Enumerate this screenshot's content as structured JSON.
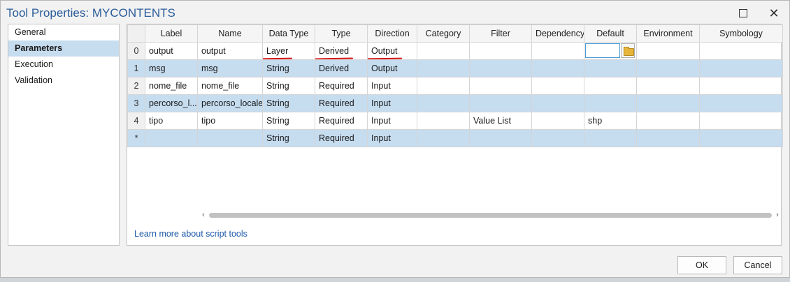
{
  "window": {
    "title": "Tool Properties: MYCONTENTS"
  },
  "nav": {
    "items": [
      {
        "label": "General",
        "selected": false
      },
      {
        "label": "Parameters",
        "selected": true
      },
      {
        "label": "Execution",
        "selected": false
      },
      {
        "label": "Validation",
        "selected": false
      }
    ]
  },
  "grid": {
    "columns": [
      "Label",
      "Name",
      "Data Type",
      "Type",
      "Direction",
      "Category",
      "Filter",
      "Dependency",
      "Default",
      "Environment",
      "Symbology"
    ],
    "rows": [
      {
        "num": "0",
        "label": "output",
        "name": "output",
        "datatype": "Layer",
        "type": "Derived",
        "direction": "Output",
        "category": "",
        "filter": "",
        "dependency": "",
        "default": "",
        "environment": "",
        "symbology": ""
      },
      {
        "num": "1",
        "label": "msg",
        "name": "msg",
        "datatype": "String",
        "type": "Derived",
        "direction": "Output",
        "category": "",
        "filter": "",
        "dependency": "",
        "default": "",
        "environment": "",
        "symbology": ""
      },
      {
        "num": "2",
        "label": "nome_file",
        "name": "nome_file",
        "datatype": "String",
        "type": "Required",
        "direction": "Input",
        "category": "",
        "filter": "",
        "dependency": "",
        "default": "",
        "environment": "",
        "symbology": ""
      },
      {
        "num": "3",
        "label": "percorso_l...",
        "name": "percorso_locale",
        "datatype": "String",
        "type": "Required",
        "direction": "Input",
        "category": "",
        "filter": "",
        "dependency": "",
        "default": "",
        "environment": "",
        "symbology": ""
      },
      {
        "num": "4",
        "label": "tipo",
        "name": "tipo",
        "datatype": "String",
        "type": "Required",
        "direction": "Input",
        "category": "",
        "filter": "Value List",
        "dependency": "",
        "default": "shp",
        "environment": "",
        "symbology": ""
      },
      {
        "num": "*",
        "label": "",
        "name": "",
        "datatype": "String",
        "type": "Required",
        "direction": "Input",
        "category": "",
        "filter": "",
        "dependency": "",
        "default": "",
        "environment": "",
        "symbology": ""
      }
    ]
  },
  "links": {
    "learn_more": "Learn more about script tools"
  },
  "buttons": {
    "ok": "OK",
    "cancel": "Cancel"
  },
  "icons": {
    "maximize": "maximize-icon",
    "close": "close-icon",
    "folder": "folder-icon",
    "scroll_left": "scroll-left-icon",
    "scroll_right": "scroll-right-icon"
  },
  "colors": {
    "title": "#2a5c9a",
    "selection": "#c6dcef",
    "annotation": "#d41414",
    "link": "#1e5aa8"
  }
}
